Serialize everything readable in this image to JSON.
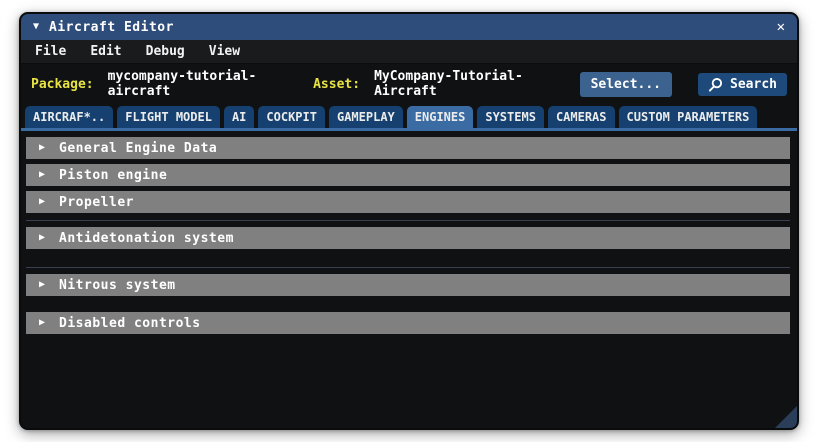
{
  "window": {
    "title": "Aircraft Editor"
  },
  "icons": {
    "window_collapse": "▼",
    "close": "✕",
    "section_expand": "▶",
    "search": "magnifying-glass"
  },
  "menu": {
    "items": [
      "File",
      "Edit",
      "Debug",
      "View"
    ]
  },
  "toolbar": {
    "package_label": "Package:",
    "package_value": "mycompany-tutorial-aircraft",
    "asset_label": "Asset:",
    "asset_value": "MyCompany-Tutorial-Aircraft",
    "select_button": "Select...",
    "search_button": "Search"
  },
  "tabs": [
    {
      "label": "AIRCRAF*..",
      "selected": false
    },
    {
      "label": "FLIGHT MODEL",
      "selected": false
    },
    {
      "label": "AI",
      "selected": false
    },
    {
      "label": "COCKPIT",
      "selected": false
    },
    {
      "label": "GAMEPLAY",
      "selected": false
    },
    {
      "label": "ENGINES",
      "selected": true
    },
    {
      "label": "SYSTEMS",
      "selected": false
    },
    {
      "label": "CAMERAS",
      "selected": false
    },
    {
      "label": "CUSTOM PARAMETERS",
      "selected": false
    }
  ],
  "sections": [
    {
      "label": "General Engine Data",
      "separator_before": false,
      "gap_before": false
    },
    {
      "label": "Piston engine",
      "separator_before": false,
      "gap_before": false
    },
    {
      "label": "Propeller",
      "separator_before": false,
      "gap_before": false
    },
    {
      "label": "Antidetonation system",
      "separator_before": true,
      "gap_before": false
    },
    {
      "label": "Nitrous system",
      "separator_before": true,
      "gap_before": true
    },
    {
      "label": "Disabled controls",
      "separator_before": false,
      "gap_before": true
    }
  ],
  "colors": {
    "titlebar_blue": "#2e4d7a",
    "tab_selected_blue": "#3a6ba3",
    "tab_unselected_blue": "#15406f",
    "accent_yellow": "#e7e345",
    "section_header_gray": "#808080",
    "select_button_blue": "#3c628f",
    "search_button_blue": "#1d4a7a",
    "content_background": "#101113"
  }
}
